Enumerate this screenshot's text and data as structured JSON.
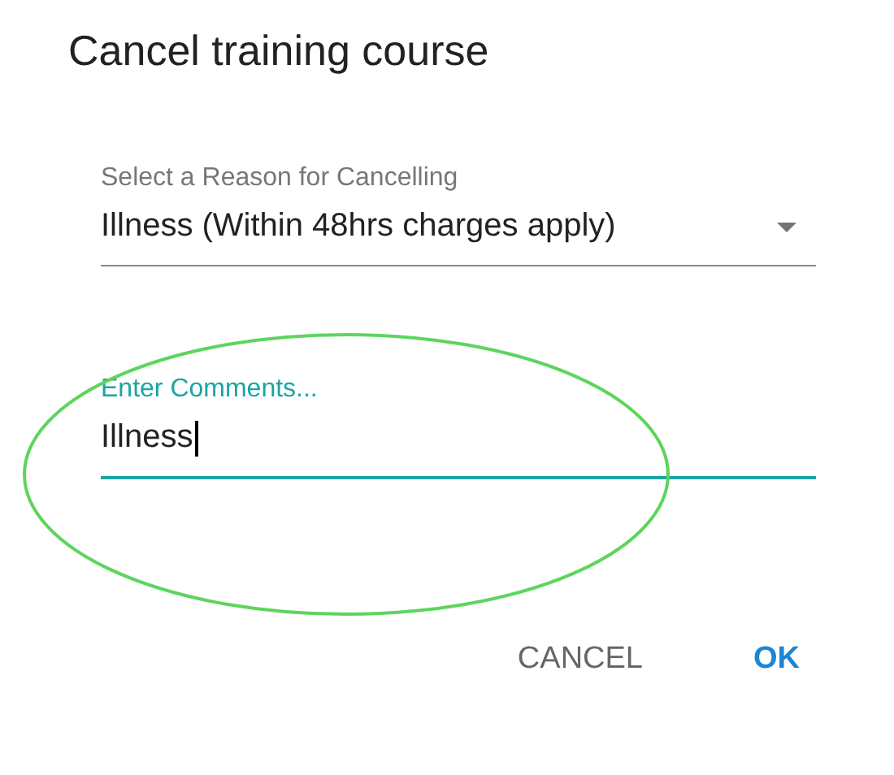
{
  "dialog": {
    "title": "Cancel training course"
  },
  "fields": [
    {
      "kind": "select",
      "label": "Select a Reason for Cancelling",
      "value": "Illness (Within 48hrs charges apply)",
      "focused": false
    },
    {
      "kind": "text",
      "label": "Enter Comments...",
      "value": "Illness",
      "focused": true
    }
  ],
  "buttons": [
    {
      "label": "CANCEL",
      "kind": "secondary"
    },
    {
      "label": "OK",
      "kind": "primary"
    }
  ]
}
